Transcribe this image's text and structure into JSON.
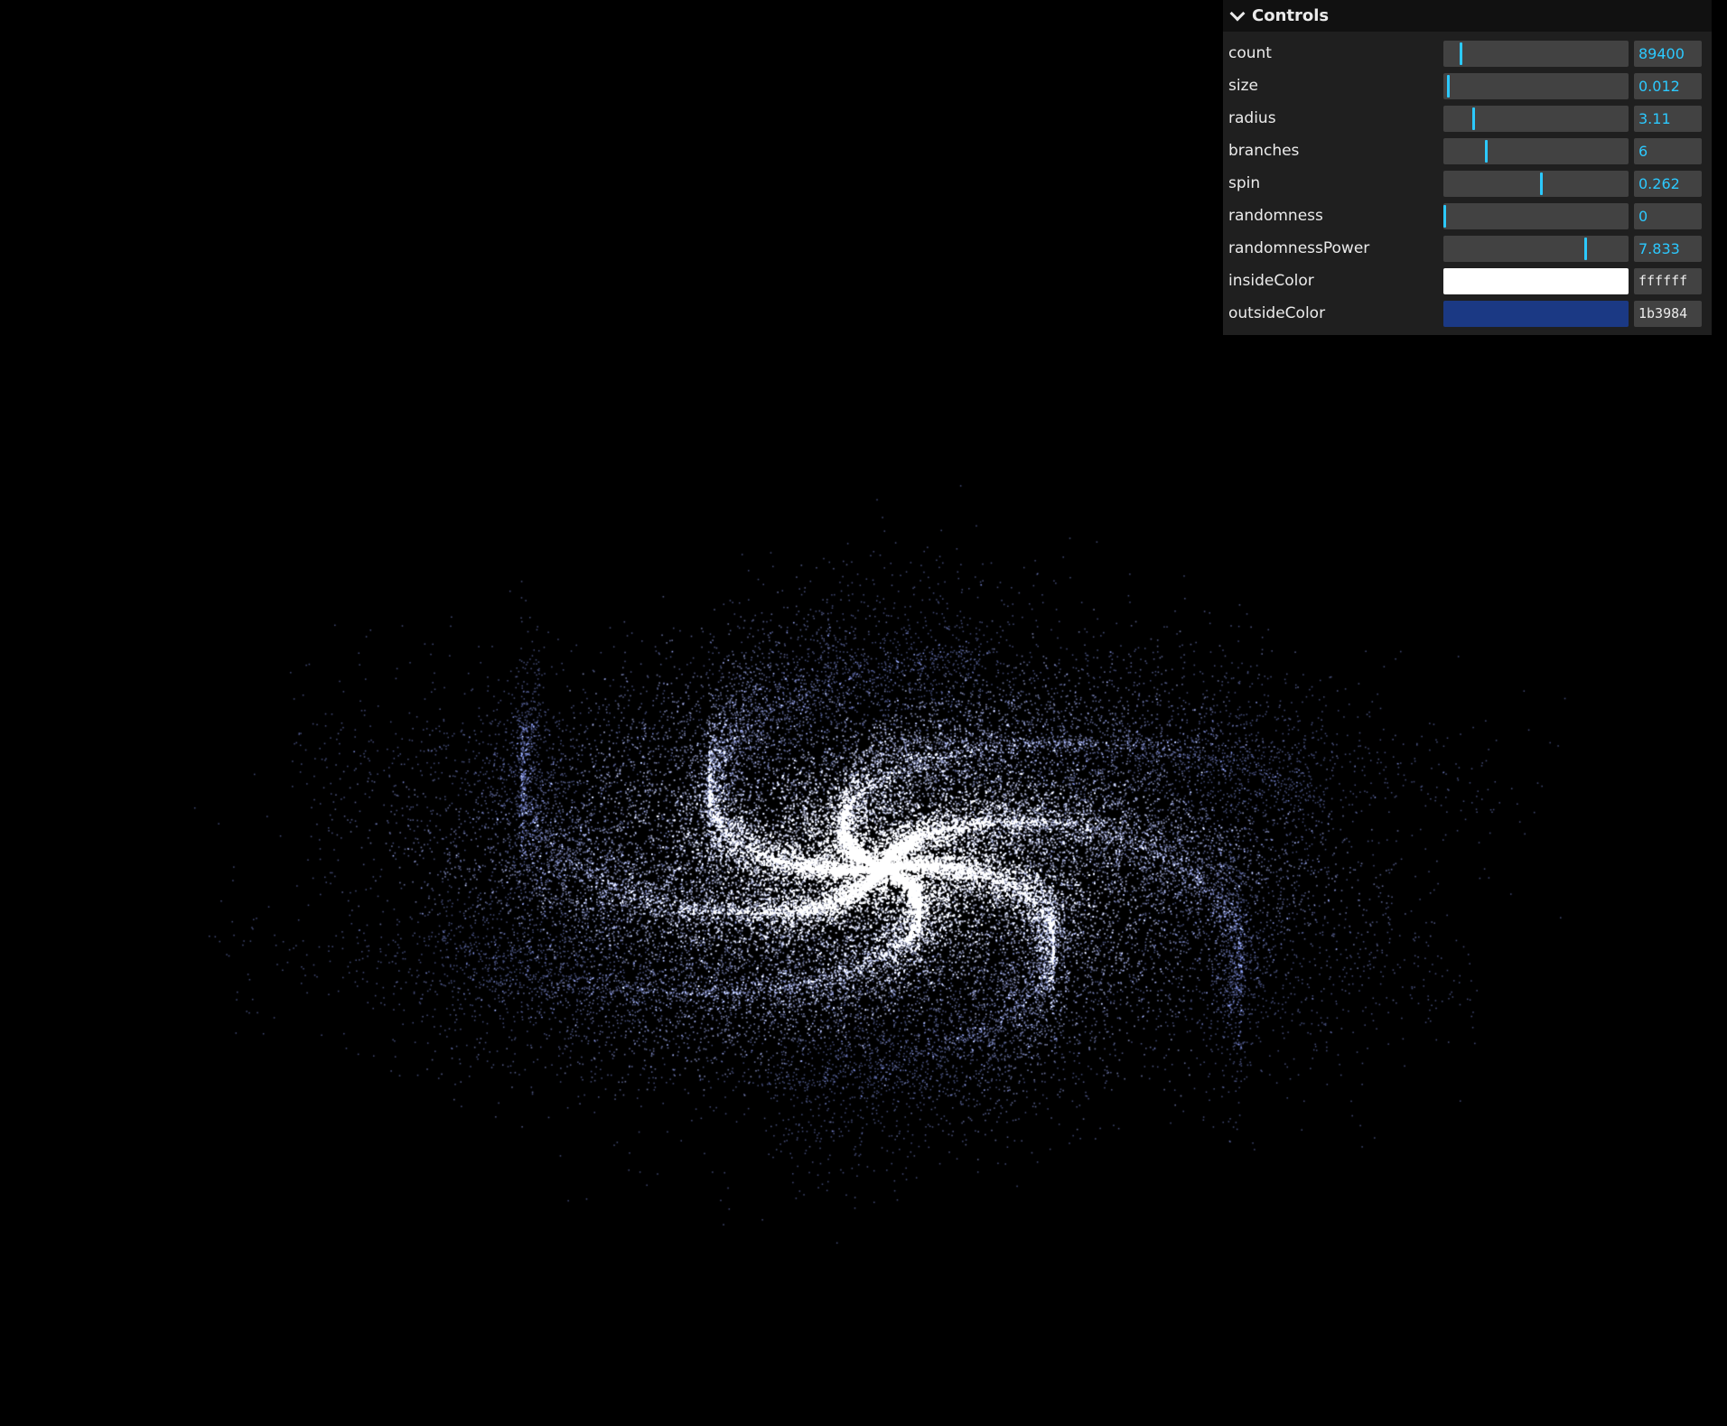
{
  "scene": {
    "background_color": "#000000",
    "galaxy": {
      "count": 89400,
      "size": 0.012,
      "radius": 3.11,
      "branches": 6,
      "spin": 0.262,
      "randomness": 0,
      "randomnessPower": 7.833,
      "insideColor": "#ffffff",
      "outsideColor": "#1b3984"
    }
  },
  "gui": {
    "title": "Controls",
    "accent_color": "#2cc9ff",
    "controls": [
      {
        "label": "count",
        "value": "89400",
        "fraction": 0.09
      },
      {
        "label": "size",
        "value": "0.012",
        "fraction": 0.02
      },
      {
        "label": "radius",
        "value": "3.11",
        "fraction": 0.16
      },
      {
        "label": "branches",
        "value": "6",
        "fraction": 0.23
      },
      {
        "label": "spin",
        "value": "0.262",
        "fraction": 0.53
      },
      {
        "label": "randomness",
        "value": "0",
        "fraction": 0.0
      },
      {
        "label": "randomnessPower",
        "value": "7.833",
        "fraction": 0.77
      }
    ],
    "colors": [
      {
        "label": "insideColor",
        "hex": "ffffff",
        "color": "#ffffff"
      },
      {
        "label": "outsideColor",
        "hex": "1b3984",
        "color": "#1b3984"
      }
    ]
  }
}
